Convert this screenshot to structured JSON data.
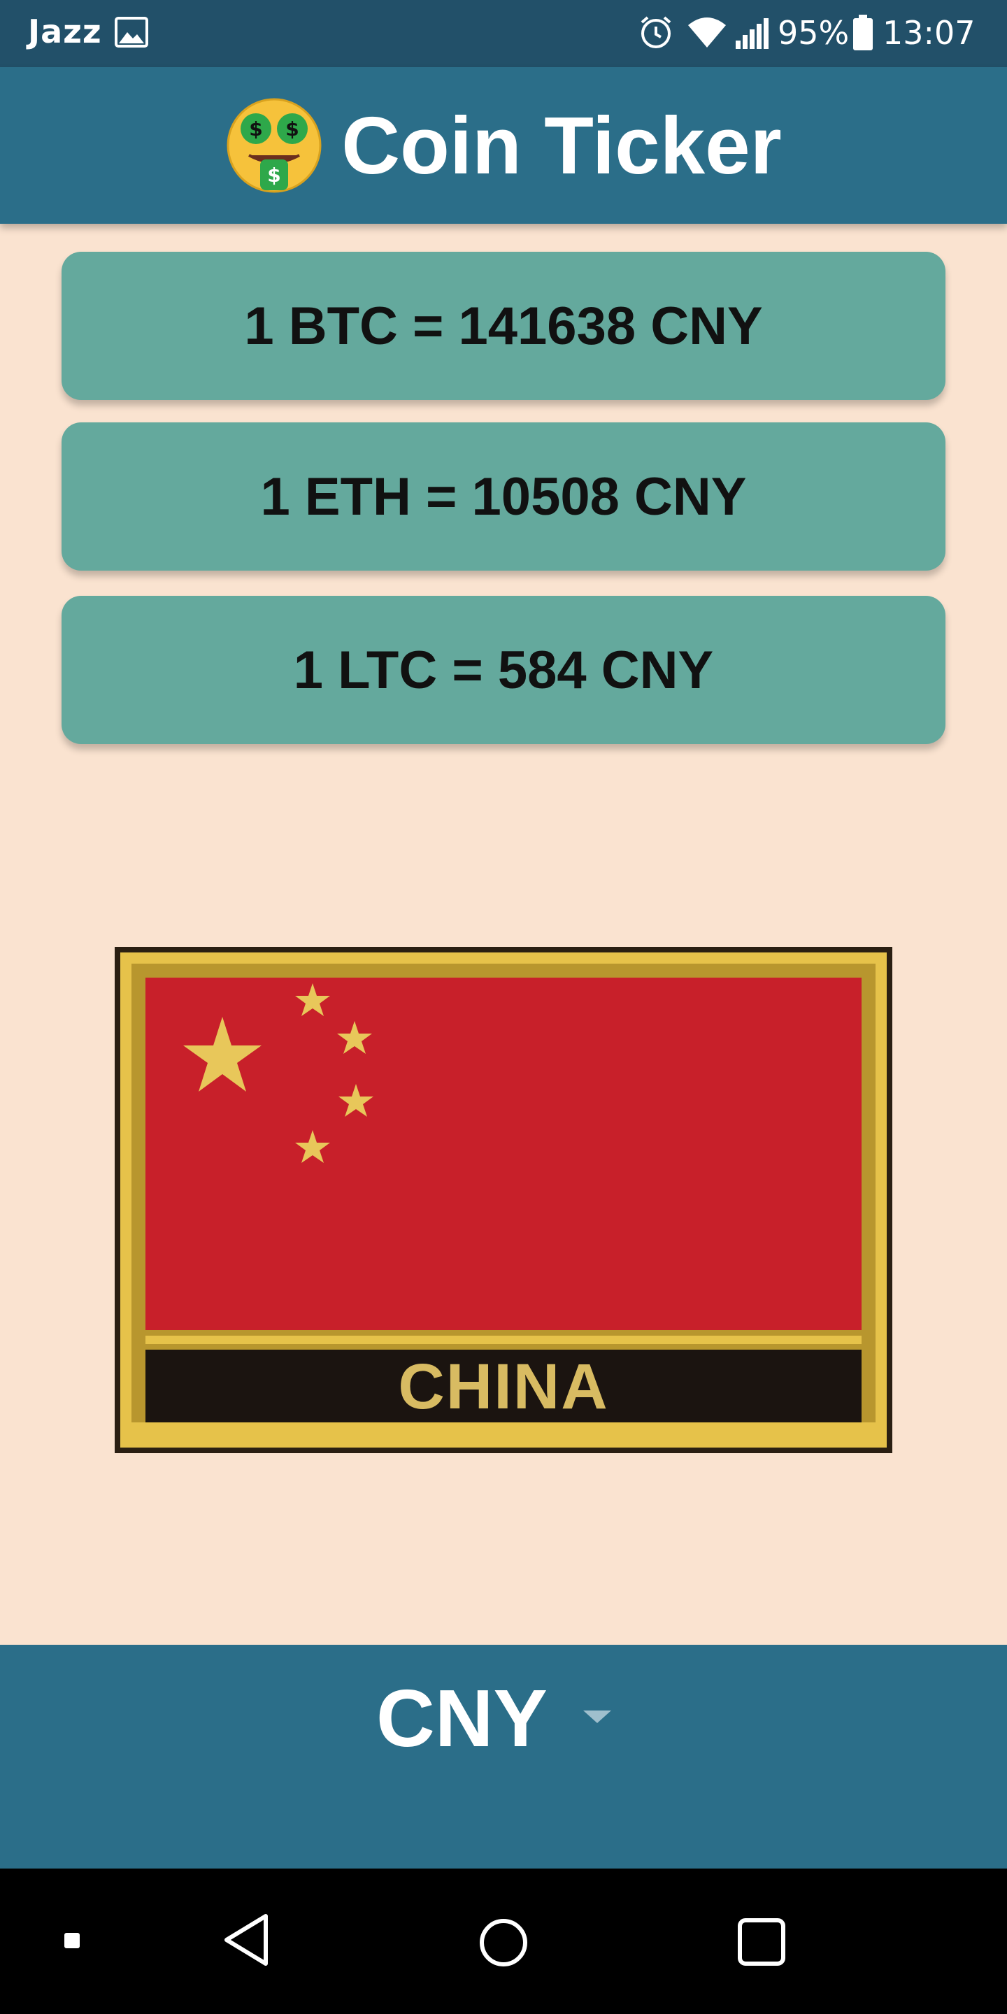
{
  "status_bar": {
    "carrier": "Jazz",
    "battery": "95%",
    "time": "13:07",
    "icons": [
      "gallery-icon",
      "alarm-icon",
      "wifi-icon",
      "signal-icon",
      "battery-icon"
    ]
  },
  "app": {
    "title": "Coin Ticker",
    "title_icon": "money-mouth-face-icon"
  },
  "rates": [
    {
      "text": "1 BTC = 141638 CNY"
    },
    {
      "text": "1 ETH = 10508 CNY"
    },
    {
      "text": "1 LTC = 584 CNY"
    }
  ],
  "flag": {
    "country_label": "CHINA",
    "colors": {
      "red": "#c8202a",
      "gold": "#e6c24a",
      "black": "#1b1410"
    }
  },
  "picker": {
    "selected": "CNY",
    "icon": "dropdown-arrow-icon"
  },
  "nav": {
    "icons": [
      "menu-dot-icon",
      "back-icon",
      "home-icon",
      "recents-icon"
    ]
  },
  "colors": {
    "status_bar": "#225069",
    "app_bar": "#2b6e89",
    "background": "#fae3d0",
    "card": "#64a99d"
  }
}
